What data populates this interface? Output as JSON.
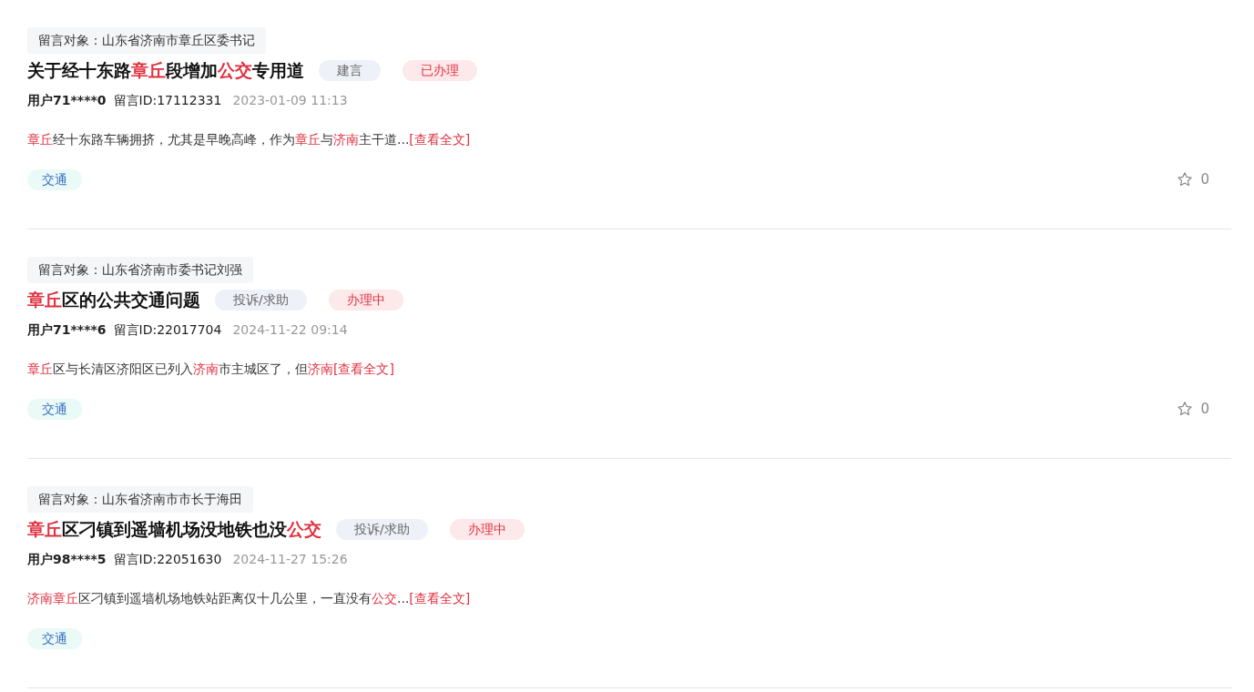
{
  "posts": [
    {
      "target": "留言对象：山东省济南市章丘区委书记",
      "title": [
        {
          "text": "关于经十东路",
          "highlight": false
        },
        {
          "text": "章丘",
          "highlight": true
        },
        {
          "text": "段增加",
          "highlight": false
        },
        {
          "text": "公交",
          "highlight": true
        },
        {
          "text": "专用道",
          "highlight": false
        }
      ],
      "type": "建言",
      "status": "已办理",
      "user": "用户71****0",
      "message_id": "留言ID:17112331",
      "time": "2023-01-09 11:13",
      "excerpt": [
        {
          "text": "章丘",
          "highlight": true
        },
        {
          "text": "经十东路车辆拥挤，尤其是早晚高峰，作为",
          "highlight": false
        },
        {
          "text": "章丘",
          "highlight": true
        },
        {
          "text": "与",
          "highlight": false
        },
        {
          "text": "济南",
          "highlight": true
        },
        {
          "text": "主干道...",
          "highlight": false
        }
      ],
      "more": "[查看全文]",
      "tag": "交通",
      "likes": "0"
    },
    {
      "target": "留言对象：山东省济南市委书记刘强",
      "title": [
        {
          "text": "章丘",
          "highlight": true
        },
        {
          "text": "区的公共交通问题",
          "highlight": false
        }
      ],
      "type": "投诉/求助",
      "status": "办理中",
      "user": "用户71****6",
      "message_id": "留言ID:22017704",
      "time": "2024-11-22 09:14",
      "excerpt": [
        {
          "text": "章丘",
          "highlight": true
        },
        {
          "text": "区与长清区济阳区已列入",
          "highlight": false
        },
        {
          "text": "济南",
          "highlight": true
        },
        {
          "text": "市主城区了，但",
          "highlight": false
        },
        {
          "text": "济南",
          "highlight": true
        }
      ],
      "more": "[查看全文]",
      "tag": "交通",
      "likes": "0"
    },
    {
      "target": "留言对象：山东省济南市市长于海田",
      "title": [
        {
          "text": "章丘",
          "highlight": true
        },
        {
          "text": "区刁镇到遥墙机场没地铁也没",
          "highlight": false
        },
        {
          "text": "公交",
          "highlight": true
        }
      ],
      "type": "投诉/求助",
      "status": "办理中",
      "user": "用户98****5",
      "message_id": "留言ID:22051630",
      "time": "2024-11-27 15:26",
      "excerpt": [
        {
          "text": "济南章丘",
          "highlight": true
        },
        {
          "text": "区刁镇到遥墙机场地铁站距离仅十几公里，一直没有",
          "highlight": false
        },
        {
          "text": "公交",
          "highlight": true
        },
        {
          "text": "...",
          "highlight": false
        }
      ],
      "more": "[查看全文]",
      "tag": "交通"
    }
  ]
}
